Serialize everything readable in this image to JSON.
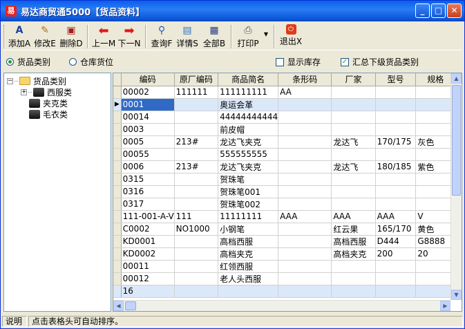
{
  "window": {
    "title": "易达商贸通5000【货品资料】"
  },
  "toolbar": {
    "buttons": [
      {
        "label": "添加A",
        "icon": "add-doc-icon"
      },
      {
        "label": "修改E",
        "icon": "edit-icon"
      },
      {
        "label": "删除D",
        "icon": "delete-icon"
      },
      {
        "label": "上一M",
        "icon": "arrow-left-icon"
      },
      {
        "label": "下一N",
        "icon": "arrow-right-icon"
      },
      {
        "label": "查询F",
        "icon": "search-icon"
      },
      {
        "label": "详情S",
        "icon": "detail-icon"
      },
      {
        "label": "全部B",
        "icon": "all-icon"
      },
      {
        "label": "打印P",
        "icon": "printer-icon"
      },
      {
        "label": "退出X",
        "icon": "exit-icon"
      }
    ]
  },
  "options": {
    "radio1": "货品类别",
    "radio2": "仓库货位",
    "check1": "显示库存",
    "check2": "汇总下级货品类别"
  },
  "tree": {
    "root": "货品类别",
    "children": [
      "西服类",
      "夹克类",
      "毛衣类"
    ]
  },
  "grid": {
    "columns": [
      "编码",
      "原厂编码",
      "商品简名",
      "条形码",
      "厂家",
      "型号",
      "规格"
    ],
    "rows": [
      [
        "00002",
        "111111",
        "111111111",
        "AA",
        "",
        "",
        ""
      ],
      [
        "0001",
        "",
        "奥运会革",
        "",
        "",
        "",
        ""
      ],
      [
        "00014",
        "",
        "44444444444",
        "",
        "",
        "",
        ""
      ],
      [
        "0003",
        "",
        "前皮帽",
        "",
        "",
        "",
        ""
      ],
      [
        "0005",
        "213#",
        "龙达飞夹克",
        "",
        "龙达飞",
        "170/175",
        "灰色"
      ],
      [
        "00055",
        "",
        "555555555",
        "",
        "",
        "",
        ""
      ],
      [
        "0006",
        "213#",
        "龙达飞夹克",
        "",
        "龙达飞",
        "180/185",
        "紫色"
      ],
      [
        "0315",
        "",
        "贺珠笔",
        "",
        "",
        "",
        ""
      ],
      [
        "0316",
        "",
        "贺珠笔001",
        "",
        "",
        "",
        ""
      ],
      [
        "0317",
        "",
        "贺珠笔002",
        "",
        "",
        "",
        ""
      ],
      [
        "111-001-A-V",
        "111",
        "11111111",
        "AAA",
        "AAA",
        "AAA",
        "V"
      ],
      [
        "C0002",
        "NO1000",
        "小钢笔",
        "",
        "红云果",
        "165/170",
        "黄色"
      ],
      [
        "KD0001",
        "",
        "高档西服",
        "",
        "高档西服",
        "D444",
        "G8888"
      ],
      [
        "KD0002",
        "",
        "高档夹克",
        "",
        "高档夹克",
        "200",
        "20"
      ],
      [
        "00011",
        "",
        "红领西服",
        "",
        "",
        "",
        ""
      ],
      [
        "00012",
        "",
        "老人头西服",
        "",
        "",
        "",
        ""
      ]
    ],
    "footer_count": "16"
  },
  "status": {
    "label": "说明",
    "text": "点击表格头可自动排序。"
  }
}
